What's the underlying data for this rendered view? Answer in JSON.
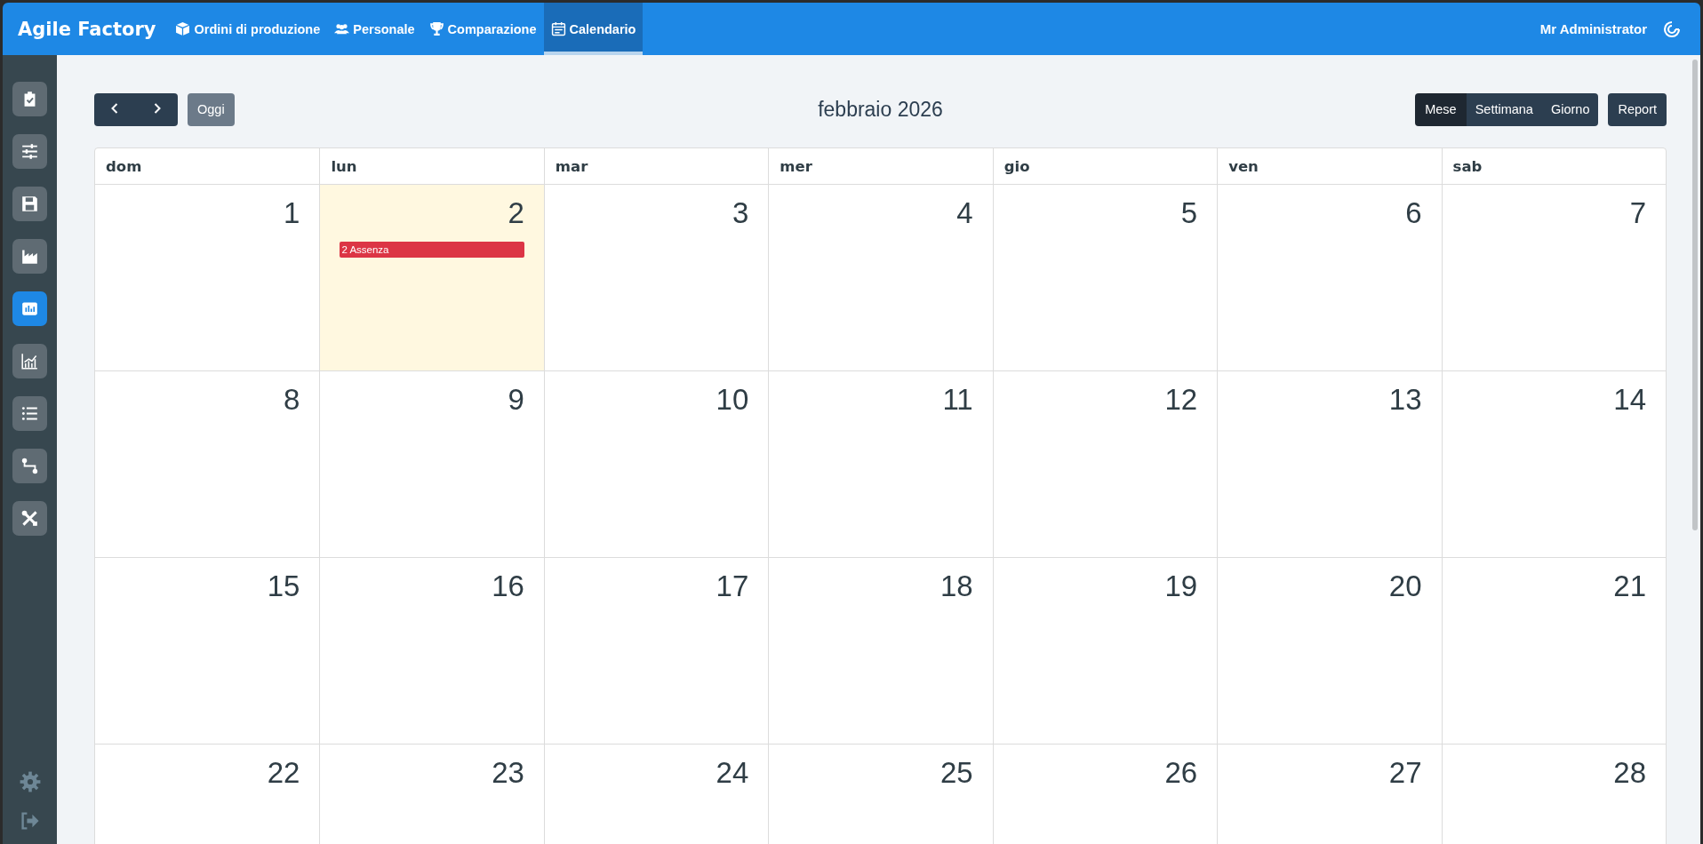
{
  "app": {
    "title": "Agile Factory"
  },
  "nav": [
    {
      "label": "Ordini di produzione",
      "selected": false
    },
    {
      "label": "Personale",
      "selected": false
    },
    {
      "label": "Comparazione",
      "selected": false
    },
    {
      "label": "Calendario",
      "selected": true
    }
  ],
  "user": {
    "name": "Mr Administrator"
  },
  "sidebar": {
    "items": [
      {
        "selected": false
      },
      {
        "selected": false
      },
      {
        "selected": false
      },
      {
        "selected": false
      },
      {
        "selected": true
      },
      {
        "selected": false
      },
      {
        "selected": false
      },
      {
        "selected": false
      },
      {
        "selected": false
      }
    ]
  },
  "toolbar": {
    "today": "Oggi",
    "title": "febbraio 2026",
    "views": [
      {
        "label": "Mese",
        "selected": true
      },
      {
        "label": "Settimana",
        "selected": false
      },
      {
        "label": "Giorno",
        "selected": false
      }
    ],
    "report": "Report"
  },
  "calendar": {
    "weekdays": [
      "dom",
      "lun",
      "mar",
      "mer",
      "gio",
      "ven",
      "sab"
    ],
    "weeks": [
      [
        {
          "day": "1",
          "today": false
        },
        {
          "day": "2",
          "today": true,
          "events": [
            {
              "title": "2 Assenza",
              "color": "#dc3545"
            }
          ]
        },
        {
          "day": "3",
          "today": false
        },
        {
          "day": "4",
          "today": false
        },
        {
          "day": "5",
          "today": false
        },
        {
          "day": "6",
          "today": false
        },
        {
          "day": "7",
          "today": false
        }
      ],
      [
        {
          "day": "8",
          "today": false
        },
        {
          "day": "9",
          "today": false
        },
        {
          "day": "10",
          "today": false
        },
        {
          "day": "11",
          "today": false
        },
        {
          "day": "12",
          "today": false
        },
        {
          "day": "13",
          "today": false
        },
        {
          "day": "14",
          "today": false
        }
      ],
      [
        {
          "day": "15",
          "today": false
        },
        {
          "day": "16",
          "today": false
        },
        {
          "day": "17",
          "today": false
        },
        {
          "day": "18",
          "today": false
        },
        {
          "day": "19",
          "today": false
        },
        {
          "day": "20",
          "today": false
        },
        {
          "day": "21",
          "today": false
        }
      ],
      [
        {
          "day": "22",
          "today": false
        },
        {
          "day": "23",
          "today": false
        },
        {
          "day": "24",
          "today": false
        },
        {
          "day": "25",
          "today": false
        },
        {
          "day": "26",
          "today": false
        },
        {
          "day": "27",
          "today": false
        },
        {
          "day": "28",
          "today": false
        }
      ]
    ]
  }
}
